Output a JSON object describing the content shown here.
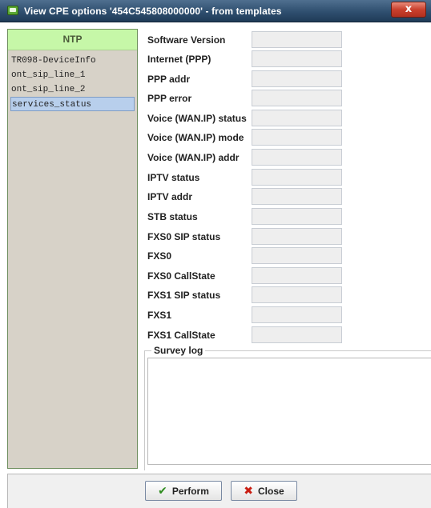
{
  "window": {
    "title": "View CPE options '454C545808000000' - from templates",
    "close_label": "x"
  },
  "left_panel": {
    "header": "NTP",
    "items": [
      {
        "label": "TR098-DeviceInfo",
        "selected": false
      },
      {
        "label": "ont_sip_line_1",
        "selected": false
      },
      {
        "label": "ont_sip_line_2",
        "selected": false
      },
      {
        "label": "services_status",
        "selected": true
      }
    ]
  },
  "fields": [
    {
      "label": "Software Version",
      "value": ""
    },
    {
      "label": "Internet (PPP)",
      "value": ""
    },
    {
      "label": "PPP addr",
      "value": ""
    },
    {
      "label": "PPP error",
      "value": ""
    },
    {
      "label": "Voice (WAN.IP) status",
      "value": ""
    },
    {
      "label": "Voice (WAN.IP) mode",
      "value": ""
    },
    {
      "label": "Voice (WAN.IP) addr",
      "value": ""
    },
    {
      "label": "IPTV status",
      "value": ""
    },
    {
      "label": "IPTV addr",
      "value": ""
    },
    {
      "label": "STB status",
      "value": ""
    },
    {
      "label": "FXS0 SIP status",
      "value": ""
    },
    {
      "label": "FXS0",
      "value": ""
    },
    {
      "label": "FXS0 CallState",
      "value": ""
    },
    {
      "label": "FXS1 SIP status",
      "value": ""
    },
    {
      "label": "FXS1",
      "value": ""
    },
    {
      "label": "FXS1 CallState",
      "value": ""
    }
  ],
  "survey": {
    "legend": "Survey log",
    "content": ""
  },
  "buttons": {
    "perform": "Perform",
    "close": "Close"
  }
}
